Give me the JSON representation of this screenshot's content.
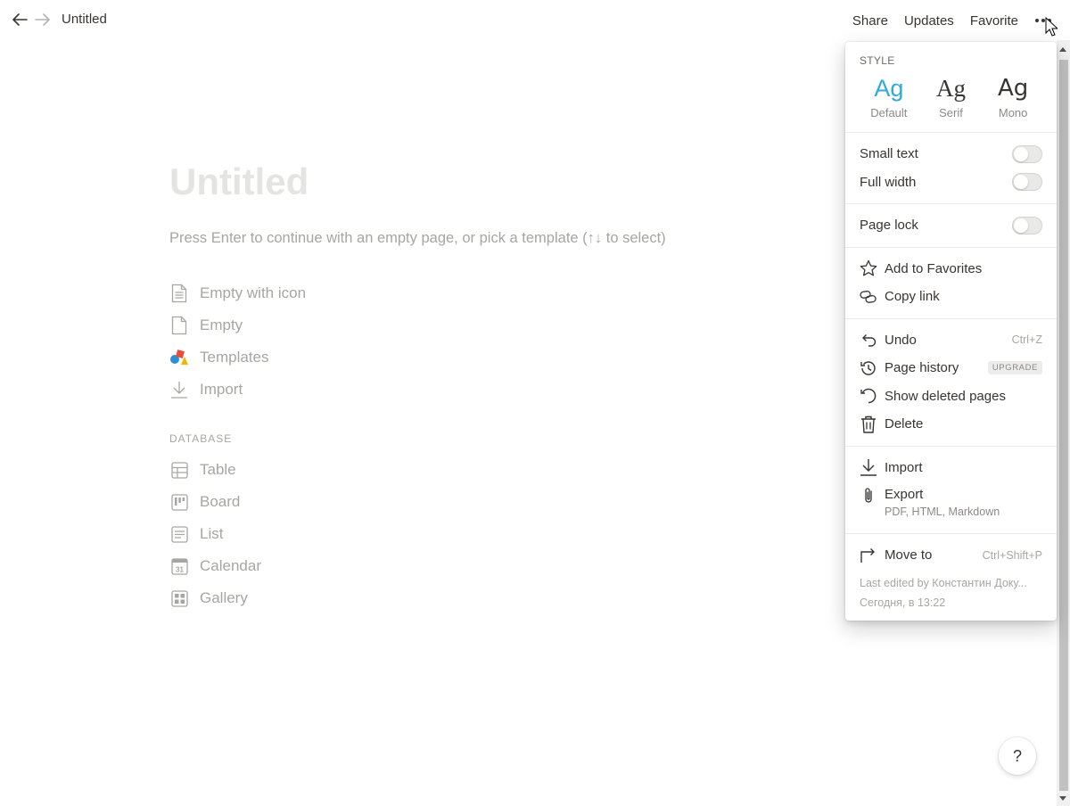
{
  "topbar": {
    "breadcrumb": "Untitled",
    "actions": [
      "Share",
      "Updates",
      "Favorite"
    ]
  },
  "main": {
    "title": "Untitled",
    "hint": "Press Enter to continue with an empty page, or pick a template (↑↓ to select)",
    "templates": [
      {
        "label": "Empty with icon",
        "icon": "page-with-text-icon"
      },
      {
        "label": "Empty",
        "icon": "blank-page-icon"
      },
      {
        "label": "Templates",
        "icon": "shapes-icon"
      },
      {
        "label": "Import",
        "icon": "download-icon"
      }
    ],
    "database_header": "DATABASE",
    "databases": [
      {
        "label": "Table",
        "icon": "table-icon"
      },
      {
        "label": "Board",
        "icon": "board-icon"
      },
      {
        "label": "List",
        "icon": "list-icon"
      },
      {
        "label": "Calendar",
        "icon": "calendar-icon",
        "icon_text": "31"
      },
      {
        "label": "Gallery",
        "icon": "gallery-icon"
      }
    ]
  },
  "menu": {
    "style_header": "STYLE",
    "styles": [
      {
        "glyph": "Ag",
        "name": "Default",
        "selected": true
      },
      {
        "glyph": "Ag",
        "name": "Serif",
        "selected": false
      },
      {
        "glyph": "Ag",
        "name": "Mono",
        "selected": false
      }
    ],
    "toggles": [
      {
        "label": "Small text",
        "on": false
      },
      {
        "label": "Full width",
        "on": false
      }
    ],
    "page_lock": {
      "label": "Page lock",
      "on": false
    },
    "favorites": [
      {
        "label": "Add to Favorites",
        "icon": "star-icon"
      },
      {
        "label": "Copy link",
        "icon": "link-icon"
      }
    ],
    "edit_actions": [
      {
        "label": "Undo",
        "icon": "undo-icon",
        "shortcut": "Ctrl+Z"
      },
      {
        "label": "Page history",
        "icon": "history-icon",
        "badge": "UPGRADE"
      },
      {
        "label": "Show deleted pages",
        "icon": "restore-icon"
      },
      {
        "label": "Delete",
        "icon": "trash-icon"
      }
    ],
    "import": {
      "label": "Import",
      "icon": "download-icon"
    },
    "export": {
      "label": "Export",
      "sub": "PDF, HTML, Markdown",
      "icon": "paperclip-icon"
    },
    "move_to": {
      "label": "Move to",
      "shortcut": "Ctrl+Shift+P",
      "icon": "move-arrow-icon"
    },
    "last_edited": "Last edited by Константин Доку...",
    "last_edited_time": "Сегодня, в 13:22"
  },
  "help": {
    "label": "?"
  },
  "colors": {
    "accent": "#2eaadc",
    "text": "#37352f",
    "muted": "#a6a6a3"
  }
}
